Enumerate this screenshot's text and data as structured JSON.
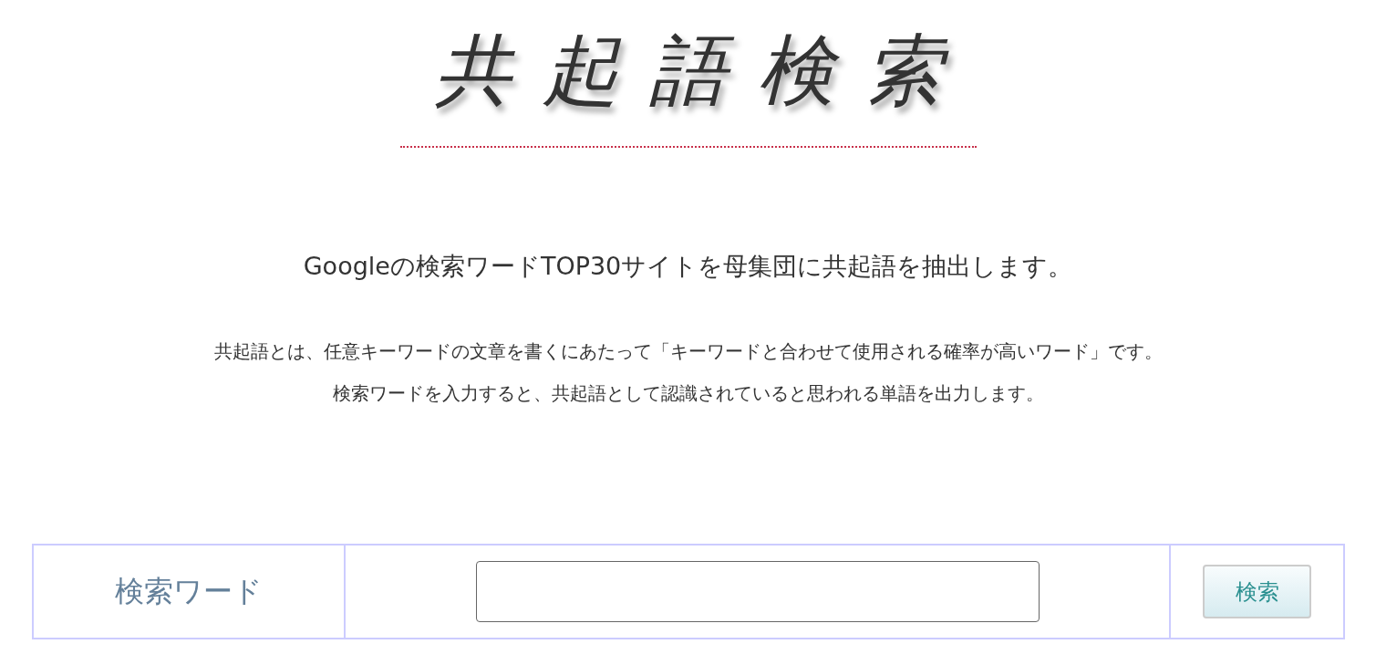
{
  "logo": {
    "text": "共起語検索"
  },
  "headline": "Googleの検索ワードTOP30サイトを母集団に共起語を抽出します。",
  "description": [
    "共起語とは、任意キーワードの文章を書くにあたって「キーワードと合わせて使用される確率が高いワード」です。",
    "検索ワードを入力すると、共起語として認識されていると思われる単語を出力します。"
  ],
  "search_form": {
    "label": "検索ワード",
    "button": "検索"
  }
}
